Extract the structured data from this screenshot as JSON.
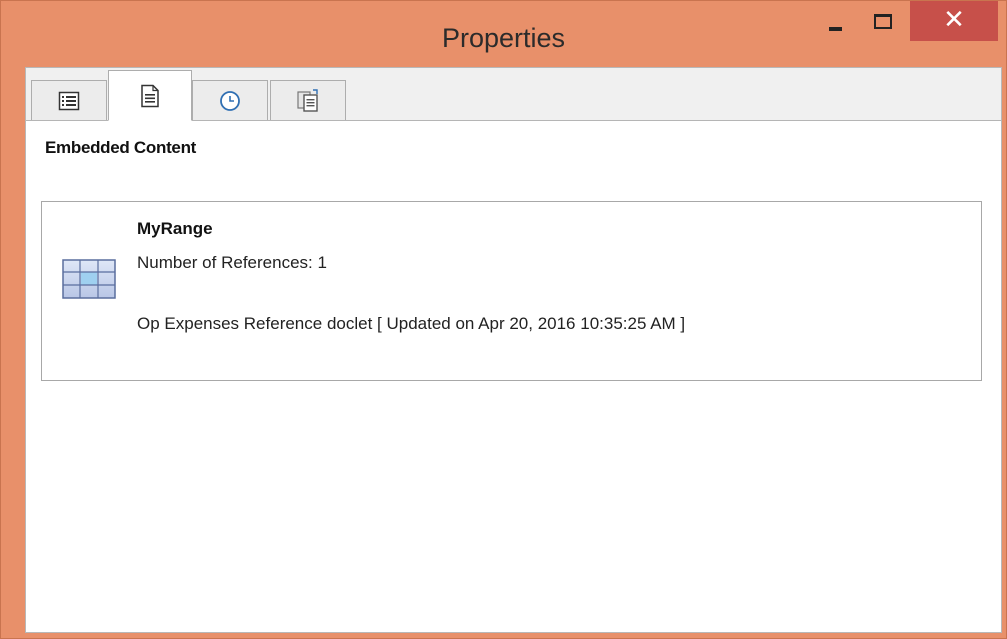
{
  "window": {
    "title": "Properties",
    "controls": {
      "minimize": "minimize",
      "maximize": "maximize",
      "close": "close"
    },
    "accent": "#e8906a",
    "close_color": "#c7504a"
  },
  "tabs": [
    {
      "icon": "list-icon",
      "active": false
    },
    {
      "icon": "document-icon",
      "active": true
    },
    {
      "icon": "clock-icon",
      "active": false
    },
    {
      "icon": "document-stack-icon",
      "active": false
    }
  ],
  "section": {
    "heading": "Embedded Content"
  },
  "embedded_item": {
    "icon": "range-grid-icon",
    "name": "MyRange",
    "references": "Number of References: 1",
    "doclet": "Op Expenses Reference doclet [ Updated on Apr 20, 2016 10:35:25 AM ]"
  }
}
